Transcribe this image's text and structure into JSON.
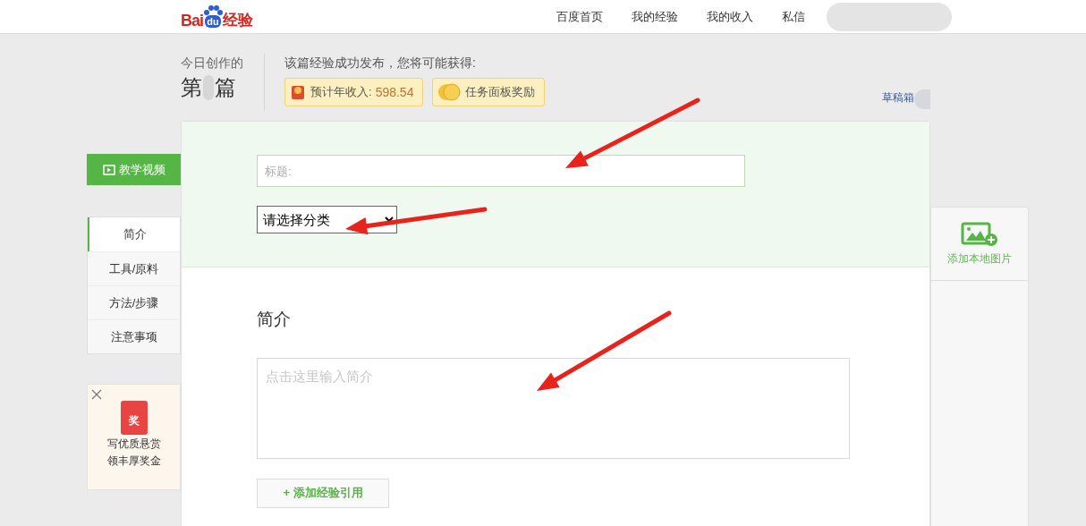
{
  "header": {
    "logo": [
      "Bai",
      "du",
      "经验"
    ],
    "nav": [
      "百度首页",
      "我的经验",
      "我的收入",
      "私信"
    ]
  },
  "summary": {
    "today_label": "今日创作的",
    "count_prefix": "第",
    "count_suffix": "篇",
    "message": "该篇经验成功发布，您将可能获得:",
    "badges": [
      {
        "kind": "income",
        "label": "预计年收入:",
        "value": "598.54"
      },
      {
        "kind": "task",
        "label": "任务面板奖励"
      }
    ],
    "drafts": "草稿箱"
  },
  "video_button": "教学视频",
  "sections": [
    {
      "label": "简介",
      "selected": true
    },
    {
      "label": "工具/原料",
      "selected": false
    },
    {
      "label": "方法/步骤",
      "selected": false
    },
    {
      "label": "注意事项",
      "selected": false
    }
  ],
  "promo": {
    "lines": [
      "写优质悬赏",
      "领丰厚奖金"
    ],
    "badge": "奖"
  },
  "form": {
    "title_placeholder": "标题:",
    "category": "请选择分类",
    "intro_heading": "简介",
    "intro_placeholder": "点击这里输入简介",
    "cite_button": "+ 添加经验引用"
  },
  "tools": [
    {
      "label": "添加本地图片"
    }
  ]
}
